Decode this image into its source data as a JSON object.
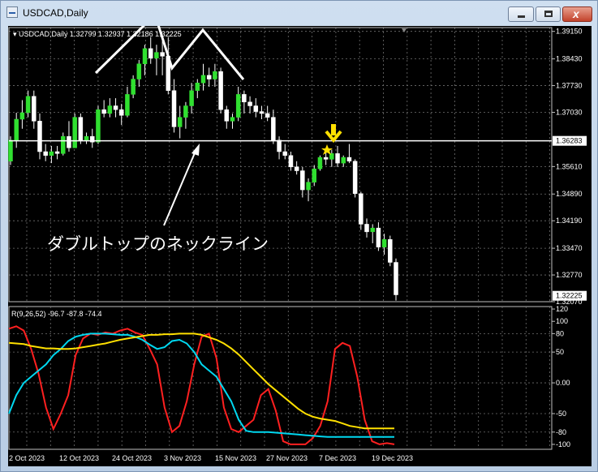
{
  "window": {
    "title": "USDCAD,Daily"
  },
  "main_chart": {
    "header": "▾ USDCAD,Daily  1.32799 1.32937 1.32186 1.32225",
    "price_scale": [
      "1.39150",
      "1.38430",
      "1.37730",
      "1.37030",
      "1.35610",
      "1.34890",
      "1.34190",
      "1.33470",
      "1.32770",
      "1.32070"
    ],
    "current_price": "1.32225",
    "neckline_price": "1.36283",
    "annotation": "ダブルトップのネックライン"
  },
  "indicator": {
    "header": "R(9,26,52) -96.7 -87.8 -74.4",
    "scale": [
      "120",
      "100",
      "80",
      "50",
      "0.00",
      "-50",
      "-80",
      "-100"
    ]
  },
  "date_axis": [
    "2 Oct 2023",
    "12 Oct 2023",
    "24 Oct 2023",
    "3 Nov 2023",
    "15 Nov 2023",
    "27 Nov 2023",
    "7 Dec 2023",
    "19 Dec 2023"
  ],
  "chart_data": {
    "type": "candlestick",
    "symbol": "USDCAD",
    "timeframe": "Daily",
    "ohlc": [
      [
        1.3575,
        1.364,
        1.3565,
        1.363
      ],
      [
        1.363,
        1.3702,
        1.361,
        1.3685
      ],
      [
        1.3685,
        1.3735,
        1.366,
        1.3702
      ],
      [
        1.3702,
        1.376,
        1.369,
        1.3745
      ],
      [
        1.3745,
        1.376,
        1.366,
        1.368
      ],
      [
        1.368,
        1.37,
        1.358,
        1.36
      ],
      [
        1.36,
        1.362,
        1.3575,
        1.359
      ],
      [
        1.359,
        1.3615,
        1.357,
        1.36
      ],
      [
        1.36,
        1.3615,
        1.358,
        1.3595
      ],
      [
        1.3595,
        1.365,
        1.359,
        1.364
      ],
      [
        1.364,
        1.368,
        1.36,
        1.361
      ],
      [
        1.361,
        1.37,
        1.361,
        1.369
      ],
      [
        1.369,
        1.37,
        1.362,
        1.363
      ],
      [
        1.363,
        1.365,
        1.362,
        1.364
      ],
      [
        1.364,
        1.366,
        1.361,
        1.3625
      ],
      [
        1.3625,
        1.372,
        1.362,
        1.371
      ],
      [
        1.371,
        1.3735,
        1.369,
        1.37
      ],
      [
        1.37,
        1.374,
        1.369,
        1.372
      ],
      [
        1.372,
        1.374,
        1.369,
        1.371
      ],
      [
        1.371,
        1.3725,
        1.367,
        1.3695
      ],
      [
        1.3695,
        1.377,
        1.369,
        1.375
      ],
      [
        1.375,
        1.38,
        1.374,
        1.379
      ],
      [
        1.379,
        1.384,
        1.377,
        1.383
      ],
      [
        1.383,
        1.388,
        1.38,
        1.387
      ],
      [
        1.387,
        1.39,
        1.383,
        1.3845
      ],
      [
        1.3845,
        1.388,
        1.38,
        1.386
      ],
      [
        1.386,
        1.389,
        1.38,
        1.385
      ],
      [
        1.385,
        1.39,
        1.375,
        1.376
      ],
      [
        1.376,
        1.379,
        1.365,
        1.3665
      ],
      [
        1.3665,
        1.372,
        1.3635,
        1.369
      ],
      [
        1.369,
        1.373,
        1.366,
        1.372
      ],
      [
        1.372,
        1.378,
        1.37,
        1.376
      ],
      [
        1.376,
        1.379,
        1.374,
        1.378
      ],
      [
        1.378,
        1.383,
        1.376,
        1.38
      ],
      [
        1.38,
        1.382,
        1.377,
        1.379
      ],
      [
        1.379,
        1.383,
        1.377,
        1.381
      ],
      [
        1.381,
        1.382,
        1.37,
        1.371
      ],
      [
        1.371,
        1.372,
        1.366,
        1.368
      ],
      [
        1.368,
        1.37,
        1.366,
        1.369
      ],
      [
        1.369,
        1.377,
        1.368,
        1.375
      ],
      [
        1.375,
        1.376,
        1.37,
        1.373
      ],
      [
        1.373,
        1.3745,
        1.37,
        1.372
      ],
      [
        1.372,
        1.374,
        1.369,
        1.3705
      ],
      [
        1.3705,
        1.372,
        1.3685,
        1.37
      ],
      [
        1.37,
        1.372,
        1.368,
        1.369
      ],
      [
        1.369,
        1.371,
        1.362,
        1.363
      ],
      [
        1.363,
        1.364,
        1.358,
        1.36
      ],
      [
        1.36,
        1.362,
        1.358,
        1.359
      ],
      [
        1.359,
        1.36,
        1.355,
        1.356
      ],
      [
        1.356,
        1.3575,
        1.354,
        1.355
      ],
      [
        1.355,
        1.356,
        1.348,
        1.35
      ],
      [
        1.35,
        1.353,
        1.347,
        1.352
      ],
      [
        1.352,
        1.3565,
        1.351,
        1.3555
      ],
      [
        1.3555,
        1.359,
        1.355,
        1.3585
      ],
      [
        1.3585,
        1.36,
        1.3565,
        1.358
      ],
      [
        1.358,
        1.3605,
        1.356,
        1.3595
      ],
      [
        1.3595,
        1.3615,
        1.356,
        1.357
      ],
      [
        1.357,
        1.359,
        1.356,
        1.3585
      ],
      [
        1.3585,
        1.362,
        1.357,
        1.3575
      ],
      [
        1.3575,
        1.358,
        1.348,
        1.349
      ],
      [
        1.349,
        1.3495,
        1.3395,
        1.341
      ],
      [
        1.341,
        1.3425,
        1.3375,
        1.339
      ],
      [
        1.339,
        1.341,
        1.336,
        1.34
      ],
      [
        1.34,
        1.3415,
        1.334,
        1.335
      ],
      [
        1.335,
        1.3385,
        1.333,
        1.337
      ],
      [
        1.337,
        1.338,
        1.33,
        1.331
      ],
      [
        1.331,
        1.332,
        1.321,
        1.3225
      ]
    ],
    "indicator_series": [
      {
        "name": "R(9)",
        "color": "#ff2020",
        "values": [
          88,
          92,
          85,
          55,
          15,
          -40,
          -75,
          -50,
          -20,
          45,
          72,
          80,
          78,
          82,
          80,
          85,
          88,
          82,
          78,
          55,
          30,
          -40,
          -80,
          -70,
          -30,
          30,
          75,
          80,
          40,
          -40,
          -75,
          -80,
          -70,
          -60,
          -20,
          -10,
          -45,
          -95,
          -100,
          -100,
          -100,
          -90,
          -70,
          -30,
          55,
          65,
          60,
          10,
          -60,
          -95,
          -100,
          -98,
          -100
        ]
      },
      {
        "name": "R(26)",
        "color": "#00d8f0",
        "values": [
          -50,
          -20,
          0,
          10,
          20,
          30,
          45,
          55,
          68,
          75,
          78,
          80,
          80,
          80,
          79,
          78,
          78,
          75,
          70,
          62,
          55,
          58,
          68,
          70,
          64,
          50,
          30,
          20,
          10,
          -10,
          -30,
          -60,
          -78,
          -80,
          -80,
          -80,
          -81,
          -82,
          -83,
          -84,
          -85,
          -86,
          -87,
          -88,
          -88,
          -88,
          -88,
          -88,
          -88,
          -88,
          -88,
          -88,
          -88
        ]
      },
      {
        "name": "R(52)",
        "color": "#ffe000",
        "values": [
          65,
          64,
          63,
          60,
          58,
          56,
          56,
          55,
          55,
          56,
          58,
          60,
          62,
          64,
          67,
          70,
          72,
          74,
          76,
          78,
          78,
          79,
          79,
          80,
          80,
          80,
          78,
          74,
          70,
          64,
          56,
          46,
          34,
          22,
          10,
          -2,
          -12,
          -22,
          -32,
          -42,
          -50,
          -55,
          -58,
          -60,
          -62,
          -66,
          -70,
          -72,
          -74,
          -74,
          -74,
          -74,
          -74
        ]
      }
    ],
    "neckline": 1.36283,
    "yrange_price": [
      1.3207,
      1.3925
    ],
    "yrange_indicator": [
      -108,
      124
    ]
  }
}
